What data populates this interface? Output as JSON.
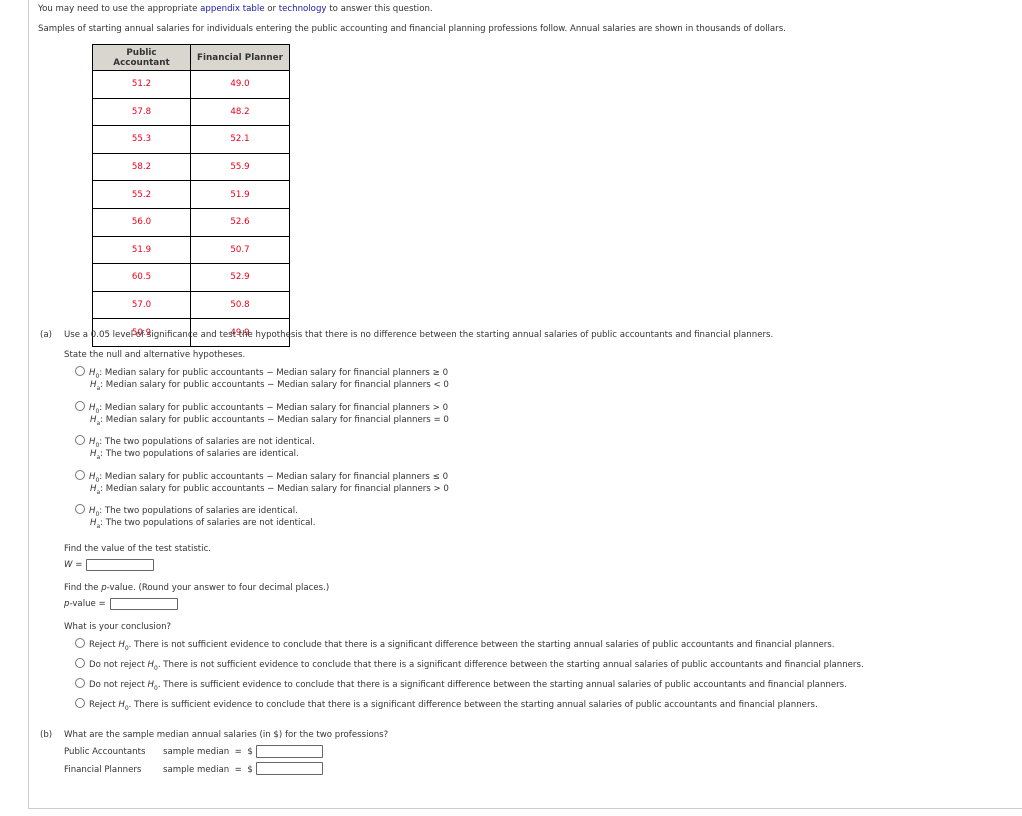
{
  "intro": {
    "prefix": "You may need to use the appropriate ",
    "link1": "appendix table",
    "middle": " or ",
    "link2": "technology",
    "suffix": " to answer this question."
  },
  "description": "Samples of starting annual salaries for individuals entering the public accounting and financial planning professions follow. Annual salaries are shown in thousands of dollars.",
  "table": {
    "headers": [
      "Public Accountant",
      "Financial Planner"
    ],
    "rows": [
      [
        "51.2",
        "49.0"
      ],
      [
        "57.8",
        "48.2"
      ],
      [
        "55.3",
        "52.1"
      ],
      [
        "58.2",
        "55.9"
      ],
      [
        "55.2",
        "51.9"
      ],
      [
        "56.0",
        "52.6"
      ],
      [
        "51.9",
        "50.7"
      ],
      [
        "60.5",
        "52.9"
      ],
      [
        "57.0",
        "50.8"
      ],
      [
        "50.9",
        "49.9"
      ]
    ]
  },
  "part_a": {
    "label": "(a)",
    "question": "Use a 0.05 level of significance and test the hypothesis that there is no difference between the starting annual salaries of public accountants and financial planners.",
    "hypotheses_prompt": "State the null and alternative hypotheses.",
    "h_letter": "H",
    "h0_sub": "0",
    "ha_sub": "a",
    "hypothesis_options": [
      {
        "h0": ": Median salary for public accountants − Median salary for financial planners ≥ 0",
        "ha": ": Median salary for public accountants − Median salary for financial planners < 0"
      },
      {
        "h0": ": Median salary for public accountants − Median salary for financial planners > 0",
        "ha": ": Median salary for public accountants − Median salary for financial planners = 0"
      },
      {
        "h0": ": The two populations of salaries are not identical.",
        "ha": ": The two populations of salaries are identical."
      },
      {
        "h0": ": Median salary for public accountants − Median salary for financial planners ≤ 0",
        "ha": ": Median salary for public accountants − Median salary for financial planners > 0"
      },
      {
        "h0": ": The two populations of salaries are identical.",
        "ha": ": The two populations of salaries are not identical."
      }
    ],
    "test_stat_prompt": "Find the value of the test statistic.",
    "test_stat_label": "W",
    "equals": " =",
    "test_stat_value": "",
    "pvalue_prompt_prefix": "Find the ",
    "pvalue_prompt_p": "p",
    "pvalue_prompt_suffix": "-value. (Round your answer to four decimal places.)",
    "pvalue_label_p": "p",
    "pvalue_label_suffix": "-value =",
    "pvalue_value": "",
    "conclusion_prompt": "What is your conclusion?",
    "conclusion_options": [
      {
        "prefix": "Reject ",
        "suffix": ". There is not sufficient evidence to conclude that there is a significant difference between the starting annual salaries of public accountants and financial planners."
      },
      {
        "prefix": "Do not reject ",
        "suffix": ". There is not sufficient evidence to conclude that there is a significant difference between the starting annual salaries of public accountants and financial planners."
      },
      {
        "prefix": "Do not reject ",
        "suffix": ". There is sufficient evidence to conclude that there is a significant difference between the starting annual salaries of public accountants and financial planners."
      },
      {
        "prefix": "Reject ",
        "suffix": ". There is sufficient evidence to conclude that there is a significant difference between the starting annual salaries of public accountants and financial planners."
      }
    ]
  },
  "part_b": {
    "label": "(b)",
    "question": "What are the sample median annual salaries (in $) for the two professions?",
    "rows": [
      {
        "group": "Public Accountants",
        "label": "sample median  =  $",
        "value": ""
      },
      {
        "group": "Financial Planners",
        "label": "sample median  =  $",
        "value": ""
      }
    ]
  }
}
